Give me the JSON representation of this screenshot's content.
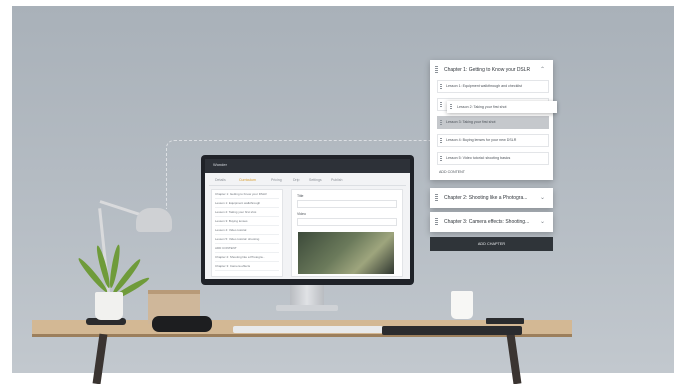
{
  "chapters_panel": {
    "chapter1": {
      "title": "Chapter 1: Getting to Know your DSLR",
      "lessons": [
        "Lesson 1: Equipment walkthrough and checklist",
        "Lesson 3: Taking your first shot",
        "Lesson 4: Buying lenses for your new DSLR",
        "Lesson 5: Video tutorial: shooting basics"
      ],
      "highlighted_lesson": "Lesson 3: Taking your first shot",
      "add_content_label": "ADD CONTENT"
    },
    "dragging_lesson": "Lesson 2: Taking your first shot",
    "chapter2": {
      "title": "Chapter 2: Shooting like a Photogra..."
    },
    "chapter3": {
      "title": "Chapter 3: Camera effects: Shooting..."
    },
    "add_chapter_label": "ADD CHAPTER"
  },
  "monitor_screen": {
    "app_title": "Wonder",
    "user": "",
    "tabs": [
      "Details",
      "Curriculum",
      "Pricing",
      "Drip",
      "Settings",
      "Publish"
    ],
    "active_tab": "Curriculum",
    "left_rows": [
      "Chapter 1: Getting to Know your DSLR",
      "Lesson 1: Equipment walkthrough",
      "Lesson 2: Taking your first shot",
      "Lesson 3: Buying lenses",
      "Lesson 4: Video tutorial",
      "Lesson 5: Video tutorial: shooting",
      "ADD CONTENT",
      "Chapter 2: Shooting like a Photogra...",
      "Chapter 3: Camera effects"
    ],
    "right_label": "Title",
    "right_label2": "Video"
  },
  "colors": {
    "accent": "#d79b29",
    "button_dark": "#2f3439",
    "highlight": "#c5c8cc"
  }
}
